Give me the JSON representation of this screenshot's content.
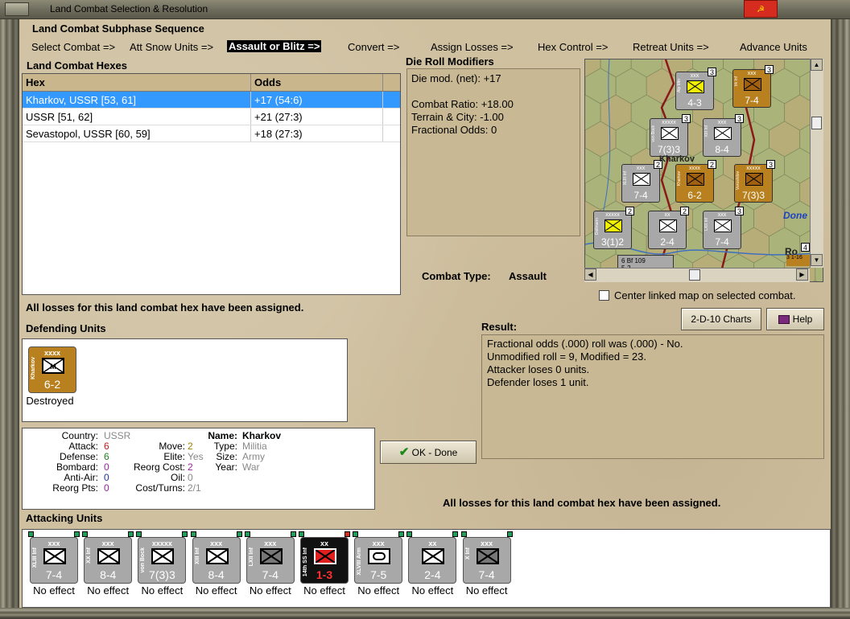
{
  "window": {
    "title": "Land Combat Selection & Resolution"
  },
  "subphase": {
    "heading": "Land Combat Subphase Sequence",
    "steps": [
      {
        "label": "Select Combat =>"
      },
      {
        "label": "Att Snow Units =>"
      },
      {
        "label": "Assault or Blitz =>"
      },
      {
        "label": "Convert =>"
      },
      {
        "label": "Assign Losses =>"
      },
      {
        "label": "Hex Control =>"
      },
      {
        "label": "Retreat Units =>"
      },
      {
        "label": "Advance Units"
      }
    ],
    "active_index": 2
  },
  "hexes": {
    "heading": "Land Combat Hexes",
    "columns": [
      "Hex",
      "Odds"
    ],
    "rows": [
      {
        "hex": "Kharkov, USSR [53, 61]",
        "odds": "+17 (54:6)",
        "selected": true
      },
      {
        "hex": "USSR [51, 62]",
        "odds": "+21 (27:3)",
        "selected": false
      },
      {
        "hex": "Sevastopol, USSR [60, 59]",
        "odds": "+18 (27:3)",
        "selected": false
      }
    ]
  },
  "drm": {
    "heading": "Die Roll Modifiers",
    "lines": [
      "Die mod. (net): +17",
      "",
      "Combat Ratio: +18.00",
      "Terrain & City: -1.00",
      "Fractional Odds: 0"
    ]
  },
  "combat_type": {
    "label": "Combat Type:",
    "value": "Assault"
  },
  "center_map": {
    "label": "Center linked map on selected combat.",
    "checked": false
  },
  "buttons": {
    "charts": "2-D-10 Charts",
    "help": "Help",
    "ok": "OK - Done"
  },
  "losses_note_top": "All losses for this land combat hex have been assigned.",
  "losses_note_bottom": "All losses for this land combat hex have been assigned.",
  "defending": {
    "heading": "Defending Units",
    "units": [
      {
        "size": "xxxx",
        "name": "Kharkov",
        "strength": "6-2",
        "status": "Destroyed",
        "color": "#b8801e",
        "symbol": "M"
      }
    ]
  },
  "result": {
    "heading": "Result:",
    "lines": [
      "Fractional odds (.000) roll was (.000)  -  No.",
      "Unmodified roll = 9, Modified = 23.",
      "Attacker loses 0 units.",
      "Defender loses 1 unit."
    ]
  },
  "unit_info": {
    "country_label": "Country:",
    "country": "USSR",
    "attack_label": "Attack:",
    "attack": "6",
    "defense_label": "Defense:",
    "defense": "6",
    "bombard_label": "Bombard:",
    "bombard": "0",
    "antiair_label": "Anti-Air:",
    "antiair": "0",
    "reorg_label": "Reorg Pts:",
    "reorg": "0",
    "move_label": "Move:",
    "move": "2",
    "elite_label": "Elite:",
    "elite": "Yes",
    "reorgcost_label": "Reorg Cost:",
    "reorgcost": "2",
    "oil_label": "Oil:",
    "oil": "0",
    "costturns_label": "Cost/Turns:",
    "costturns": "2/1",
    "name_label": "Name:",
    "name": "Kharkov",
    "type_label": "Type:",
    "type": "Militia",
    "size_label": "Size:",
    "size": "Army",
    "year_label": "Year:",
    "year": "War"
  },
  "attacking": {
    "heading": "Attacking Units",
    "units": [
      {
        "size": "xxx",
        "name": "XLIII Inf",
        "strength": "7-4",
        "status": "No effect",
        "color": "#a8a8a8",
        "sym": "inf"
      },
      {
        "size": "xxx",
        "name": "XX Inf",
        "strength": "8-4",
        "status": "No effect",
        "color": "#a8a8a8",
        "sym": "inf"
      },
      {
        "size": "xxxxx",
        "name": "von Bock",
        "strength": "7(3)3",
        "status": "No effect",
        "color": "#a8a8a8",
        "sym": "inf"
      },
      {
        "size": "xxx",
        "name": "XIII Inf",
        "strength": "8-4",
        "status": "No effect",
        "color": "#a8a8a8",
        "sym": "inf"
      },
      {
        "size": "xxx",
        "name": "LXII Inf",
        "strength": "7-4",
        "status": "No effect",
        "color": "#a8a8a8",
        "sym": "infdark"
      },
      {
        "size": "xx",
        "name": "14th SS Inf",
        "strength": "1-3",
        "status": "No effect",
        "color": "#111111",
        "sym": "red"
      },
      {
        "size": "xxx",
        "name": "XLVIII Arm",
        "strength": "7-5",
        "status": "No effect",
        "color": "#a8a8a8",
        "sym": "arm"
      },
      {
        "size": "xx",
        "name": "",
        "strength": "2-4",
        "status": "No effect",
        "color": "#a8a8a8",
        "sym": "inf"
      },
      {
        "size": "xxx",
        "name": "X Inf",
        "strength": "7-4",
        "status": "No effect",
        "color": "#a8a8a8",
        "sym": "infdark"
      }
    ]
  },
  "map": {
    "done_label": "Done",
    "counters": [
      {
        "label": "4-3",
        "size": "xxx",
        "color": "#a8a8a8",
        "badge": "3",
        "name": "Alp Mtn"
      },
      {
        "label": "7-4",
        "size": "xxx",
        "color": "#b8801e",
        "badge": "3",
        "name": "Irk Inf"
      },
      {
        "label": "7(3)3",
        "size": "xxxxx",
        "color": "#a8a8a8",
        "badge": "3",
        "name": "von Bock"
      },
      {
        "label": "8-4",
        "size": "xxx",
        "color": "#a8a8a8",
        "badge": "3",
        "name": "XIII Inf"
      },
      {
        "label": "7-4",
        "size": "xxx",
        "color": "#a8a8a8",
        "badge": "2",
        "name": "XLIII Inf"
      },
      {
        "label": "6-2",
        "size": "xxxx",
        "color": "#b8801e",
        "badge": "2",
        "name": "Kharkov"
      },
      {
        "label": "7(3)3",
        "size": "xxxxx",
        "color": "#b8801e",
        "badge": "3",
        "name": "Voroshilov"
      },
      {
        "label": "3(1)2",
        "size": "xxxxx",
        "color": "#a8a8a8",
        "badge": "2",
        "name": "Dollmann"
      },
      {
        "label": "2-4",
        "size": "xx",
        "color": "#a8a8a8",
        "badge": "2",
        "name": ""
      },
      {
        "label": "7-4",
        "size": "xxx",
        "color": "#a8a8a8",
        "badge": "3",
        "name": "LXII Inf"
      }
    ],
    "city": "Kharkov",
    "air_unit": "Bf 109",
    "air_value": "6",
    "air_strength": "5-2",
    "edge_label": "Ro",
    "stack_badge": "4",
    "corner_unit": "3  1-16"
  }
}
